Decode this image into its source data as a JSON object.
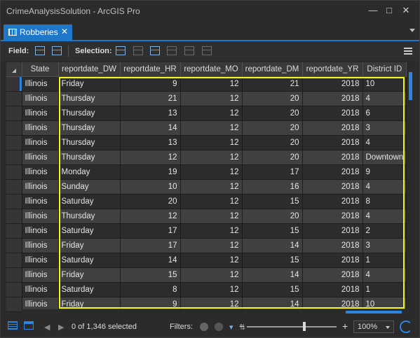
{
  "window": {
    "title": "CrimeAnalysisSolution - ArcGIS Pro"
  },
  "tab": {
    "label": "Robberies",
    "close": "✕"
  },
  "toolbar": {
    "field_label": "Field:",
    "selection_label": "Selection:"
  },
  "grid": {
    "columns": [
      "State",
      "reportdate_DW",
      "reportdate_HR",
      "reportdate_MO",
      "reportdate_DM",
      "reportdate_YR",
      "District ID"
    ],
    "rows": [
      [
        "Illinois",
        "Friday",
        "9",
        "12",
        "21",
        "2018",
        "10"
      ],
      [
        "Illinois",
        "Thursday",
        "21",
        "12",
        "20",
        "2018",
        "4"
      ],
      [
        "Illinois",
        "Thursday",
        "13",
        "12",
        "20",
        "2018",
        "6"
      ],
      [
        "Illinois",
        "Thursday",
        "14",
        "12",
        "20",
        "2018",
        "3"
      ],
      [
        "Illinois",
        "Thursday",
        "13",
        "12",
        "20",
        "2018",
        "4"
      ],
      [
        "Illinois",
        "Thursday",
        "12",
        "12",
        "20",
        "2018",
        "Downtown"
      ],
      [
        "Illinois",
        "Monday",
        "19",
        "12",
        "17",
        "2018",
        "9"
      ],
      [
        "Illinois",
        "Sunday",
        "10",
        "12",
        "16",
        "2018",
        "4"
      ],
      [
        "Illinois",
        "Saturday",
        "20",
        "12",
        "15",
        "2018",
        "8"
      ],
      [
        "Illinois",
        "Thursday",
        "12",
        "12",
        "20",
        "2018",
        "4"
      ],
      [
        "Illinois",
        "Saturday",
        "17",
        "12",
        "15",
        "2018",
        "2"
      ],
      [
        "Illinois",
        "Friday",
        "17",
        "12",
        "14",
        "2018",
        "3"
      ],
      [
        "Illinois",
        "Saturday",
        "14",
        "12",
        "15",
        "2018",
        "1"
      ],
      [
        "Illinois",
        "Friday",
        "15",
        "12",
        "14",
        "2018",
        "4"
      ],
      [
        "Illinois",
        "Saturday",
        "8",
        "12",
        "15",
        "2018",
        "1"
      ],
      [
        "Illinois",
        "Friday",
        "9",
        "12",
        "14",
        "2018",
        "10"
      ]
    ]
  },
  "status": {
    "selected_text": "0 of 1,346 selected",
    "filters_label": "Filters:",
    "zoom": "100%",
    "minus": "−",
    "plus": "+"
  },
  "colors": {
    "accent": "#1f77c9",
    "highlight": "#f5f518"
  }
}
